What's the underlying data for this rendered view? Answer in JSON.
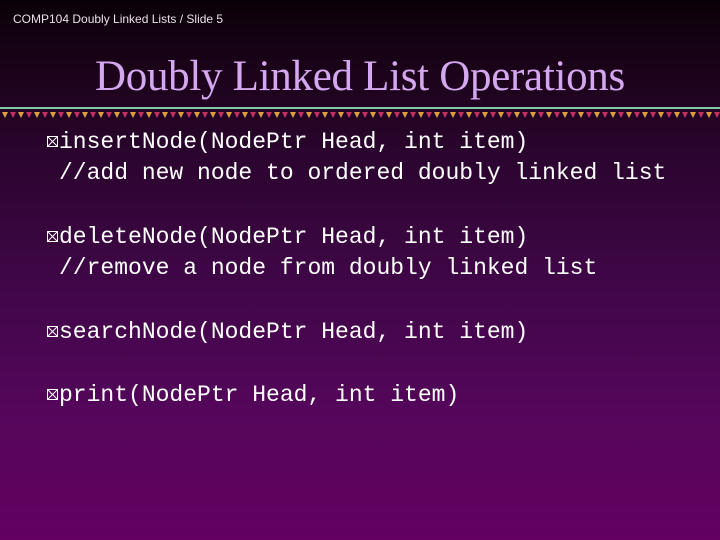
{
  "header": {
    "footer_label": "COMP104 Doubly Linked Lists / Slide 5"
  },
  "slide": {
    "title": "Doubly Linked List Operations",
    "bullet_icon": "envelope-x-box-icon",
    "colors": {
      "title": "#d4a8f0",
      "body_text": "#ffffff",
      "rule_line": "#7fc8a6",
      "triangle_pink": "#c03060",
      "triangle_gold": "#e0a040",
      "background_top": "#0a0008",
      "background_bottom": "#630060"
    },
    "bullets": [
      {
        "signature": "insertNode(NodePtr Head, int item)",
        "comment": "//add new node to ordered doubly linked list"
      },
      {
        "signature": "deleteNode(NodePtr Head, int item)",
        "comment": "//remove a node from doubly linked list"
      },
      {
        "signature": "searchNode(NodePtr Head, int item)",
        "comment": null
      },
      {
        "signature": "print(NodePtr Head, int item)",
        "comment": null
      }
    ]
  }
}
